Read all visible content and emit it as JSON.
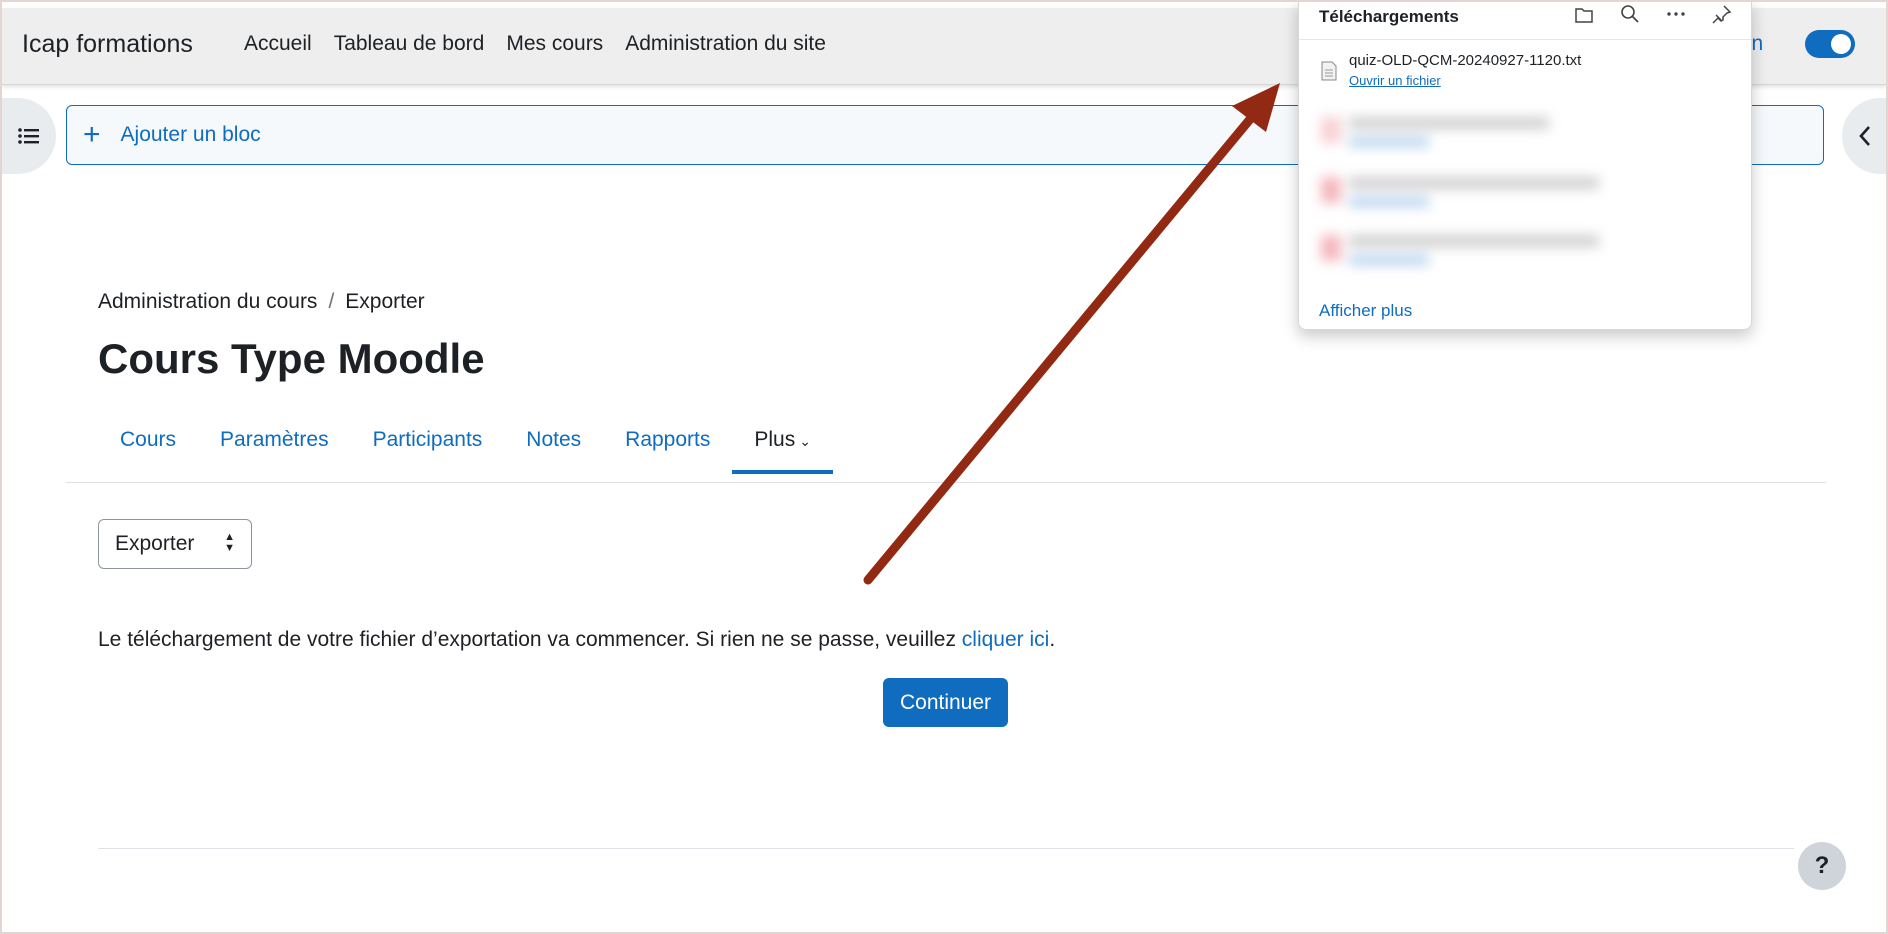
{
  "navbar": {
    "brand": "Icap formations",
    "links": [
      "Accueil",
      "Tableau de bord",
      "Mes cours",
      "Administration du site"
    ],
    "edit_mode_label": "lition",
    "edit_mode_on": true
  },
  "add_block": {
    "label": "Ajouter un bloc"
  },
  "breadcrumb": {
    "items": [
      "Administration du cours",
      "Exporter"
    ],
    "separator": "/"
  },
  "page": {
    "title": "Cours Type Moodle"
  },
  "tabs": {
    "items": [
      "Cours",
      "Paramètres",
      "Participants",
      "Notes",
      "Rapports"
    ],
    "more_label": "Plus",
    "active": "Plus"
  },
  "select": {
    "value": "Exporter"
  },
  "message": {
    "text": "Le téléchargement de votre fichier d’exportation va commencer. Si rien ne se passe, veuillez ",
    "link": "cliquer ici",
    "end": "."
  },
  "buttons": {
    "continue": "Continuer",
    "help": "?"
  },
  "downloads": {
    "title": "Téléchargements",
    "file_name": "quiz-OLD-QCM-20240927-1120.txt",
    "open_label": "Ouvrir un fichier",
    "show_more": "Afficher plus"
  },
  "annotation": {
    "arrow_color": "#922a13"
  },
  "colors": {
    "accent": "#0f6cbf",
    "navbar_bg": "#eeeeee"
  }
}
